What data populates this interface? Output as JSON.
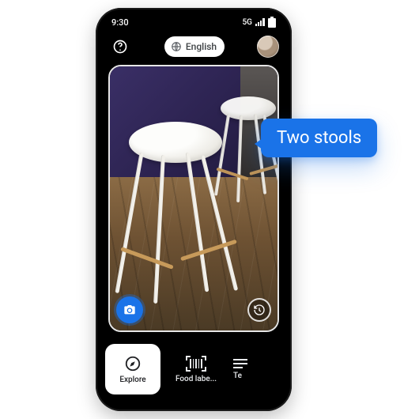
{
  "statusbar": {
    "time": "9:30",
    "network": "5G"
  },
  "toprow": {
    "language": "English"
  },
  "bubble": {
    "text": "Two stools"
  },
  "modes": {
    "explore": "Explore",
    "food": "Food labe...",
    "text_partial": "Te"
  }
}
